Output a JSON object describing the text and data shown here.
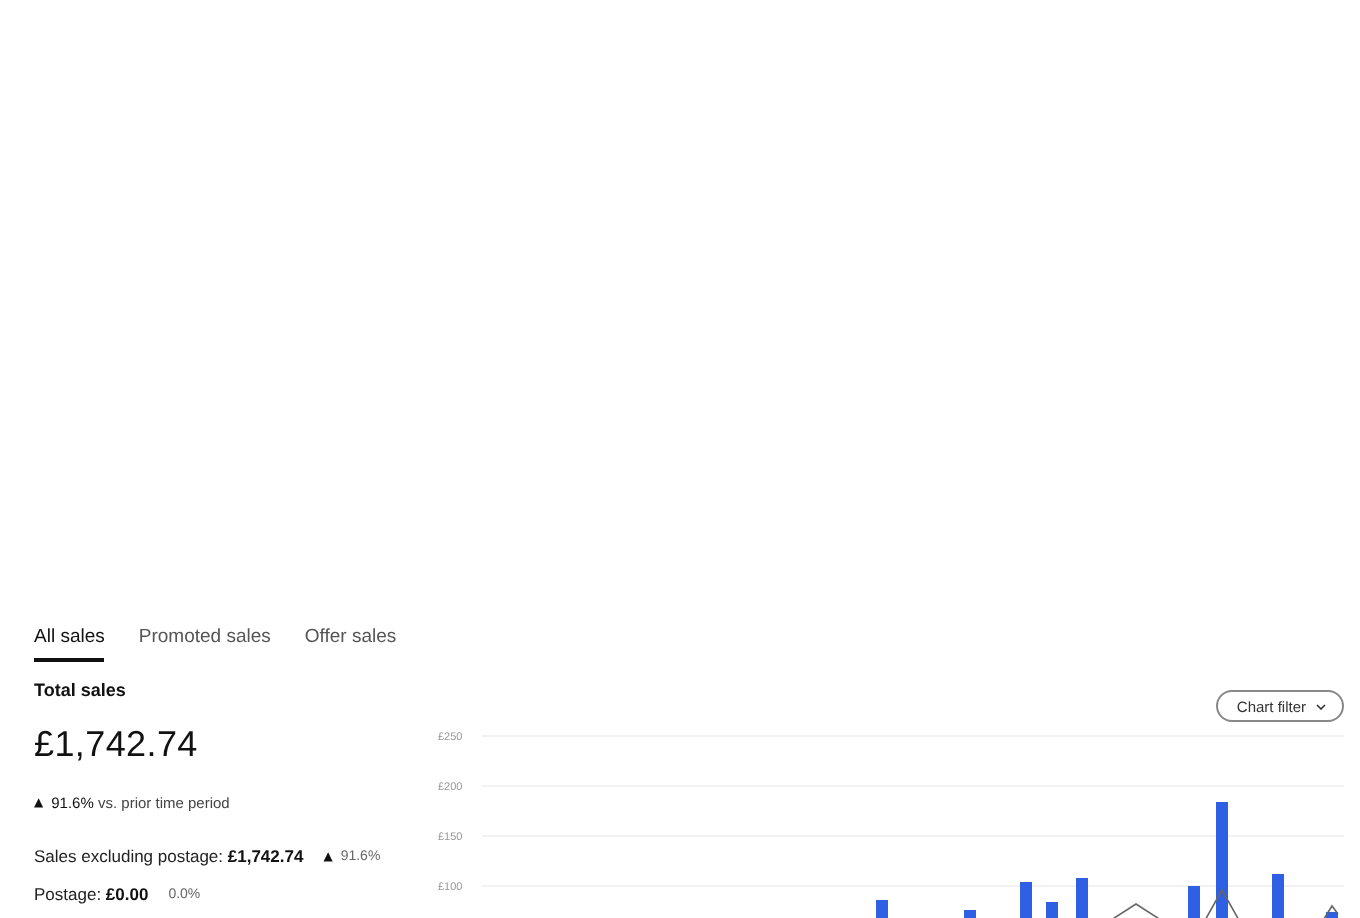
{
  "tabs": [
    {
      "label": "All sales",
      "selected": true
    },
    {
      "label": "Promoted sales",
      "selected": false
    },
    {
      "label": "Offer sales",
      "selected": false
    }
  ],
  "summary": {
    "title": "Total sales",
    "amount": "£1,742.74",
    "arrow": "▲",
    "change": "**91.6%** vs. prior time period"
  },
  "breakdown": [
    {
      "label": "Sales excluding postage: **£1,742.74**",
      "arrow": "▲",
      "change": "91.6%"
    },
    {
      "label": "Postage: **£0.00**",
      "change": "0.0%"
    }
  ],
  "chart": {
    "filter_button": "Chart filter",
    "y_labels": [
      "£250",
      "£200",
      "£150",
      "£100"
    ]
  }
}
